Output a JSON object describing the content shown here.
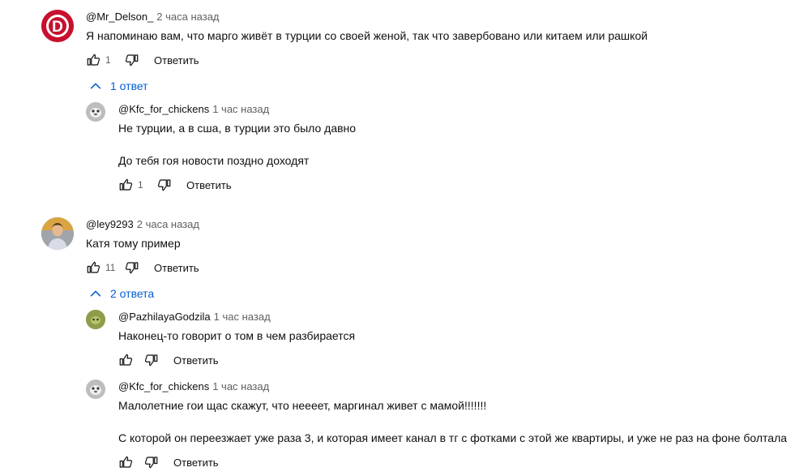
{
  "comments": [
    {
      "author": "@Mr_Delson_",
      "time": "2 часа назад",
      "text_lines": [
        "Я напоминаю вам, что марго живёт в турции со своей женой, так что завербовано или китаем или рашкой"
      ],
      "likes": "1",
      "reply_label": "Ответить",
      "replies_toggle": "1 ответ",
      "avatar_letter": "D",
      "replies": [
        {
          "author": "@Kfc_for_chickens",
          "time": "1 час назад",
          "text_lines": [
            "Не турции, а в сша, в турции это было давно",
            "До тебя гоя новости поздно доходят"
          ],
          "likes": "1",
          "reply_label": "Ответить"
        }
      ]
    },
    {
      "author": "@ley9293",
      "time": "2 часа назад",
      "text_lines": [
        "Катя тому пример"
      ],
      "likes": "11",
      "reply_label": "Ответить",
      "replies_toggle": "2 ответа",
      "replies": [
        {
          "author": "@PazhilayaGodzila",
          "time": "1 час назад",
          "text_lines": [
            "Наконец-то говорит о том в чем разбирается"
          ],
          "likes": "",
          "reply_label": "Ответить"
        },
        {
          "author": "@Kfc_for_chickens",
          "time": "1 час назад",
          "text_lines": [
            "Малолетние гои щас скажут, что нееeет, маргинал живет с мамой!!!!!!!",
            "С которой он переезжает уже раза 3, и которая имеет канал в тг с фотками с этой же квартиры, и уже не раз на фоне болтала"
          ],
          "likes": "",
          "reply_label": "Ответить"
        }
      ]
    }
  ],
  "colors": {
    "accent": "#065fd4",
    "secondary_text": "#606060",
    "primary_text": "#0f0f0f",
    "avatar_d": "#c8102e"
  }
}
